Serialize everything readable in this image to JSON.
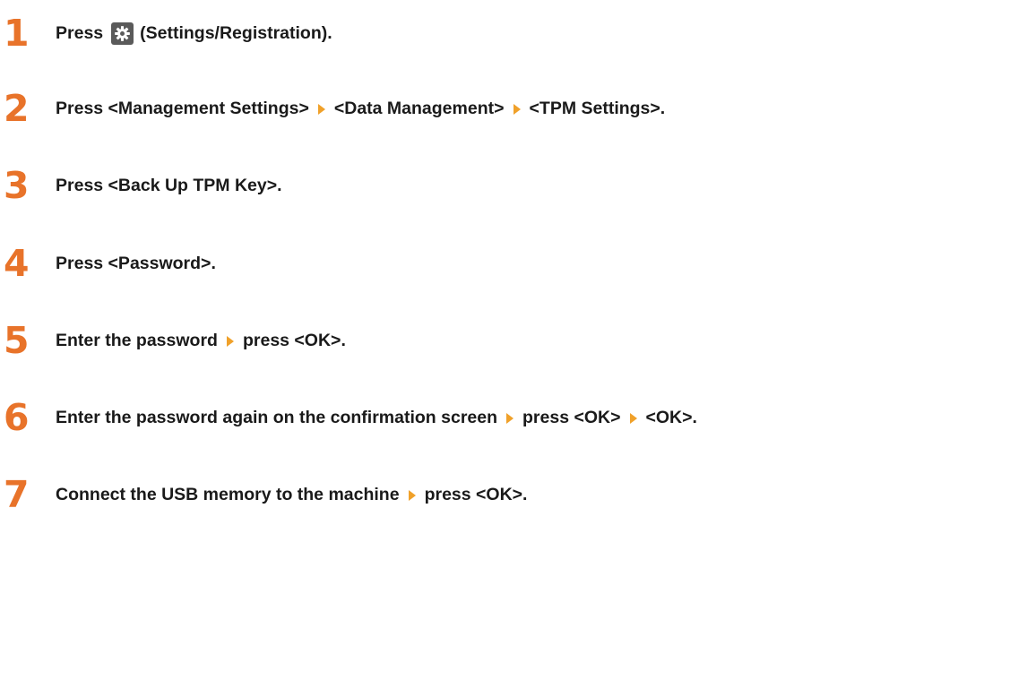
{
  "colors": {
    "step_number": "#e8732a",
    "arrow": "#f0a12a",
    "text": "#1a1a1a",
    "icon_bg": "#5a5a5a"
  },
  "steps": [
    {
      "number": "1",
      "parts": [
        "Press",
        "(Settings/Registration)."
      ],
      "icon": "settings-gear-icon"
    },
    {
      "number": "2",
      "parts": [
        "Press <Management Settings>",
        "<Data Management>",
        "<TPM Settings>."
      ]
    },
    {
      "number": "3",
      "parts": [
        "Press <Back Up TPM Key>."
      ]
    },
    {
      "number": "4",
      "parts": [
        "Press <Password>."
      ]
    },
    {
      "number": "5",
      "parts": [
        "Enter the password",
        "press <OK>."
      ]
    },
    {
      "number": "6",
      "parts": [
        "Enter the password again on the confirmation screen",
        "press <OK>",
        "<OK>."
      ]
    },
    {
      "number": "7",
      "parts": [
        "Connect the USB memory to the machine",
        "press <OK>."
      ]
    }
  ]
}
